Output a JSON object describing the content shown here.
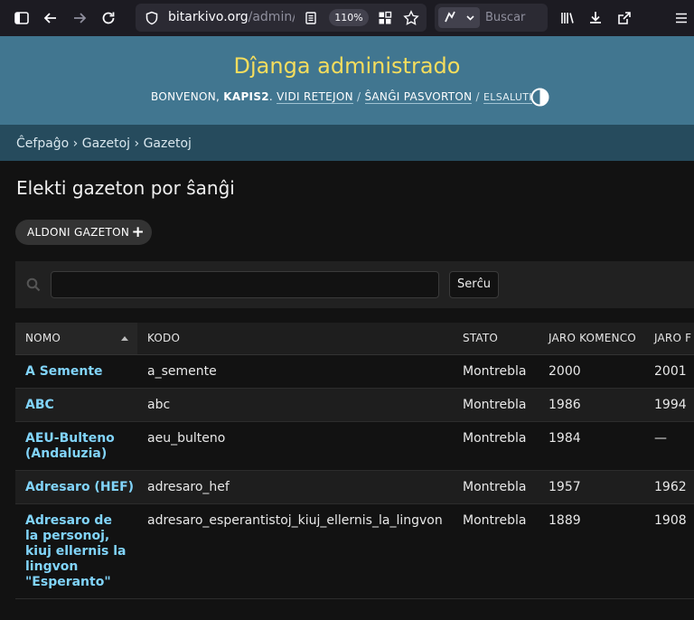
{
  "browser": {
    "url_host": "bitarkivo.org",
    "url_path": "/admin/g",
    "zoom": "110%",
    "search_placeholder": "Buscar"
  },
  "header": {
    "branding": "Dĵanga administrado",
    "welcome": "BONVENON,",
    "username": "KAPIS2",
    "view_site": "VIDI RETEJON",
    "change_password": "ŜANĜI PASVORTON",
    "logout": "ELSALUTI"
  },
  "breadcrumbs": "Ĉefpaĝo › Gazetoj › Gazetoj",
  "page": {
    "title": "Elekti gazeton por ŝanĝi",
    "add_button": "ALDONI GAZETON",
    "search_value": "",
    "search_button": "Serĉu"
  },
  "table": {
    "columns": [
      "NOMO",
      "KODO",
      "STATO",
      "JARO KOMENCO",
      "JARO F"
    ],
    "rows": [
      {
        "nomo": "A Semente",
        "kodo": "a_semente",
        "stato": "Montrebla",
        "komenco": "2000",
        "fino": "2001"
      },
      {
        "nomo": "ABC",
        "kodo": "abc",
        "stato": "Montrebla",
        "komenco": "1986",
        "fino": "1994"
      },
      {
        "nomo": "AEU-Bulteno (Andaluzia)",
        "kodo": "aeu_bulteno",
        "stato": "Montrebla",
        "komenco": "1984",
        "fino": "—"
      },
      {
        "nomo": "Adresaro (HEF)",
        "kodo": "adresaro_hef",
        "stato": "Montrebla",
        "komenco": "1957",
        "fino": "1962"
      },
      {
        "nomo": "Adresaro de la personoj, kiuj ellernis la lingvon \"Esperanto\"",
        "kodo": "adresaro_esperantistoj_kiuj_ellernis_la_lingvon",
        "stato": "Montrebla",
        "komenco": "1889",
        "fino": "1908"
      }
    ]
  },
  "colors": {
    "header_bg": "#417690",
    "branding": "#f5dd5d",
    "breadcrumbs_bg": "#264b5d",
    "link": "#81d4fa",
    "page_bg": "#121212"
  },
  "icons": [
    "sidebar-icon",
    "back-icon",
    "forward-icon",
    "reload-icon",
    "shield-icon",
    "reader-icon",
    "extensions-grid-icon",
    "star-icon",
    "search-engine-icon",
    "library-icon",
    "download-icon",
    "share-icon",
    "menu-icon",
    "theme-toggle-icon",
    "search-icon"
  ]
}
